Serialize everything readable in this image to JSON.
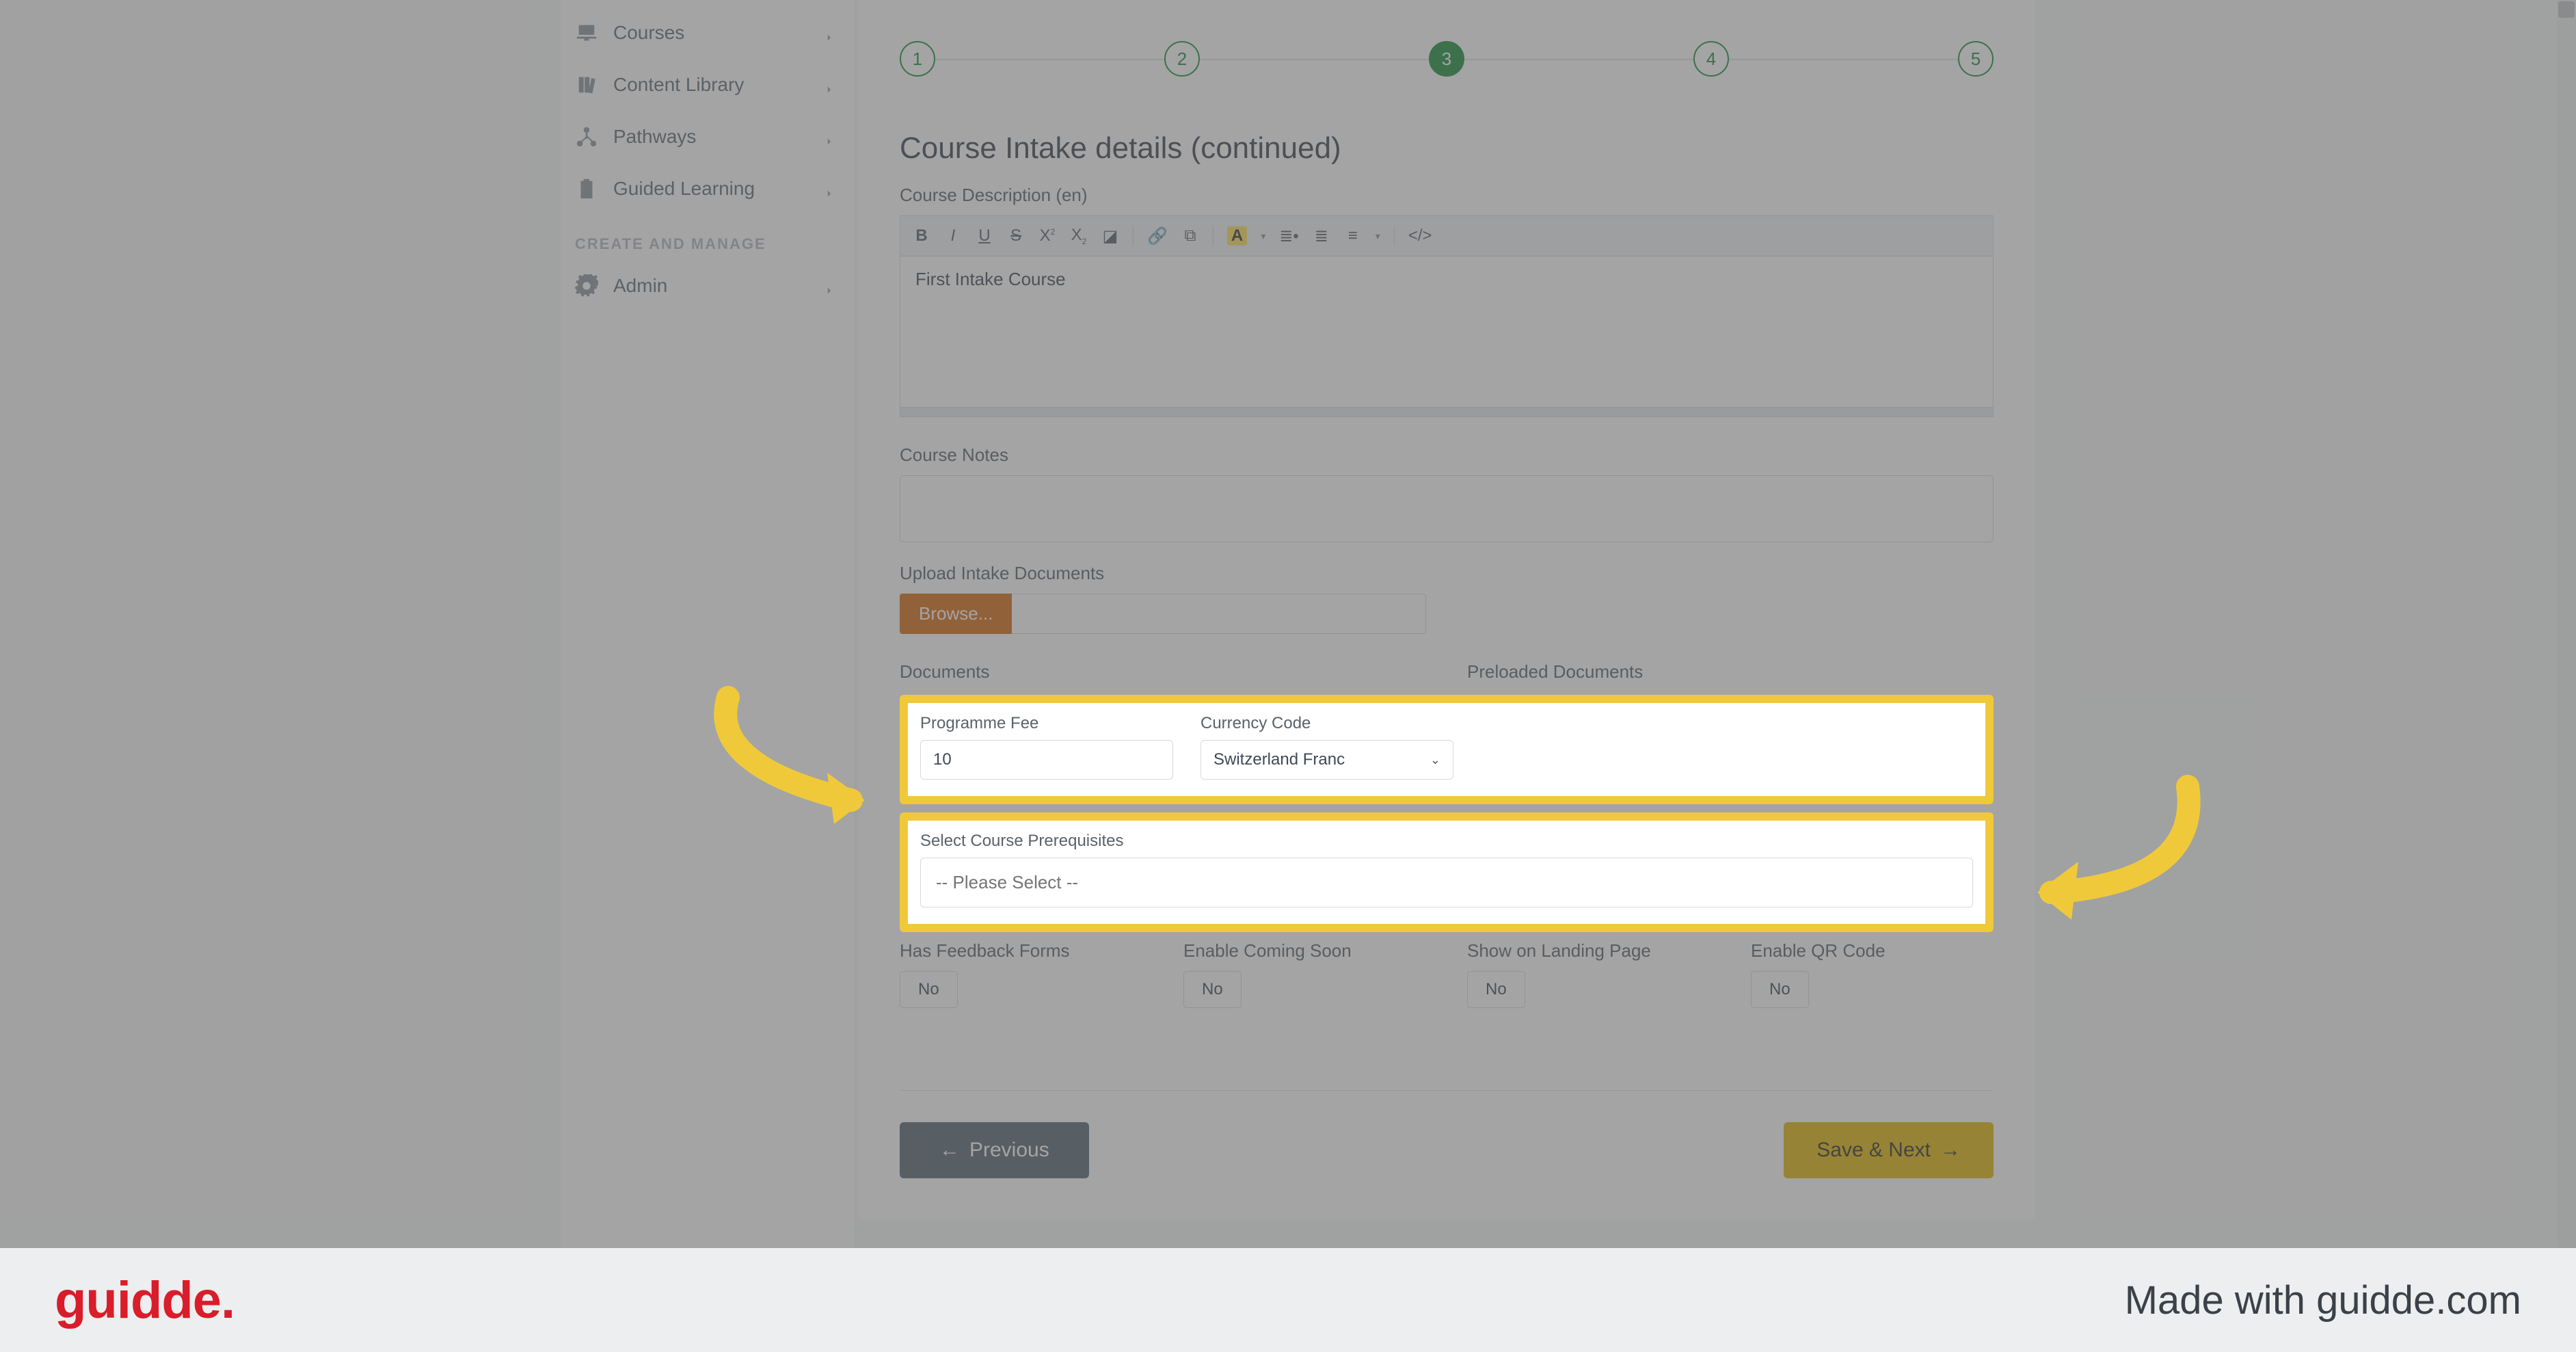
{
  "sidebar": {
    "items": [
      {
        "label": "Courses"
      },
      {
        "label": "Content Library"
      },
      {
        "label": "Pathways"
      },
      {
        "label": "Guided Learning"
      }
    ],
    "section": "CREATE AND MANAGE",
    "admin": {
      "label": "Admin"
    }
  },
  "stepper": {
    "steps": [
      "1",
      "2",
      "3",
      "4",
      "5"
    ],
    "active_index": 2
  },
  "section_title": "Course Intake details (continued)",
  "desc_label": "Course Description (en)",
  "desc_content": "First Intake Course",
  "notes_label": "Course Notes",
  "upload_label": "Upload Intake Documents",
  "browse_btn": "Browse...",
  "docs_label": "Documents",
  "preloaded_label": "Preloaded Documents",
  "fee_label": "Programme Fee",
  "fee_value": "10",
  "currency_label": "Currency Code",
  "currency_value": "Switzerland Franc",
  "prereq_label": "Select Course Prerequisites",
  "prereq_placeholder": "-- Please Select --",
  "toggles": [
    {
      "label": "Has Feedback Forms",
      "value": "No"
    },
    {
      "label": "Enable Coming Soon",
      "value": "No"
    },
    {
      "label": "Show on Landing Page",
      "value": "No"
    },
    {
      "label": "Enable QR Code",
      "value": "No"
    }
  ],
  "prev_btn": "Previous",
  "next_btn": "Save & Next",
  "footer": {
    "logo": "guidde.",
    "made": "Made with guidde.com"
  }
}
